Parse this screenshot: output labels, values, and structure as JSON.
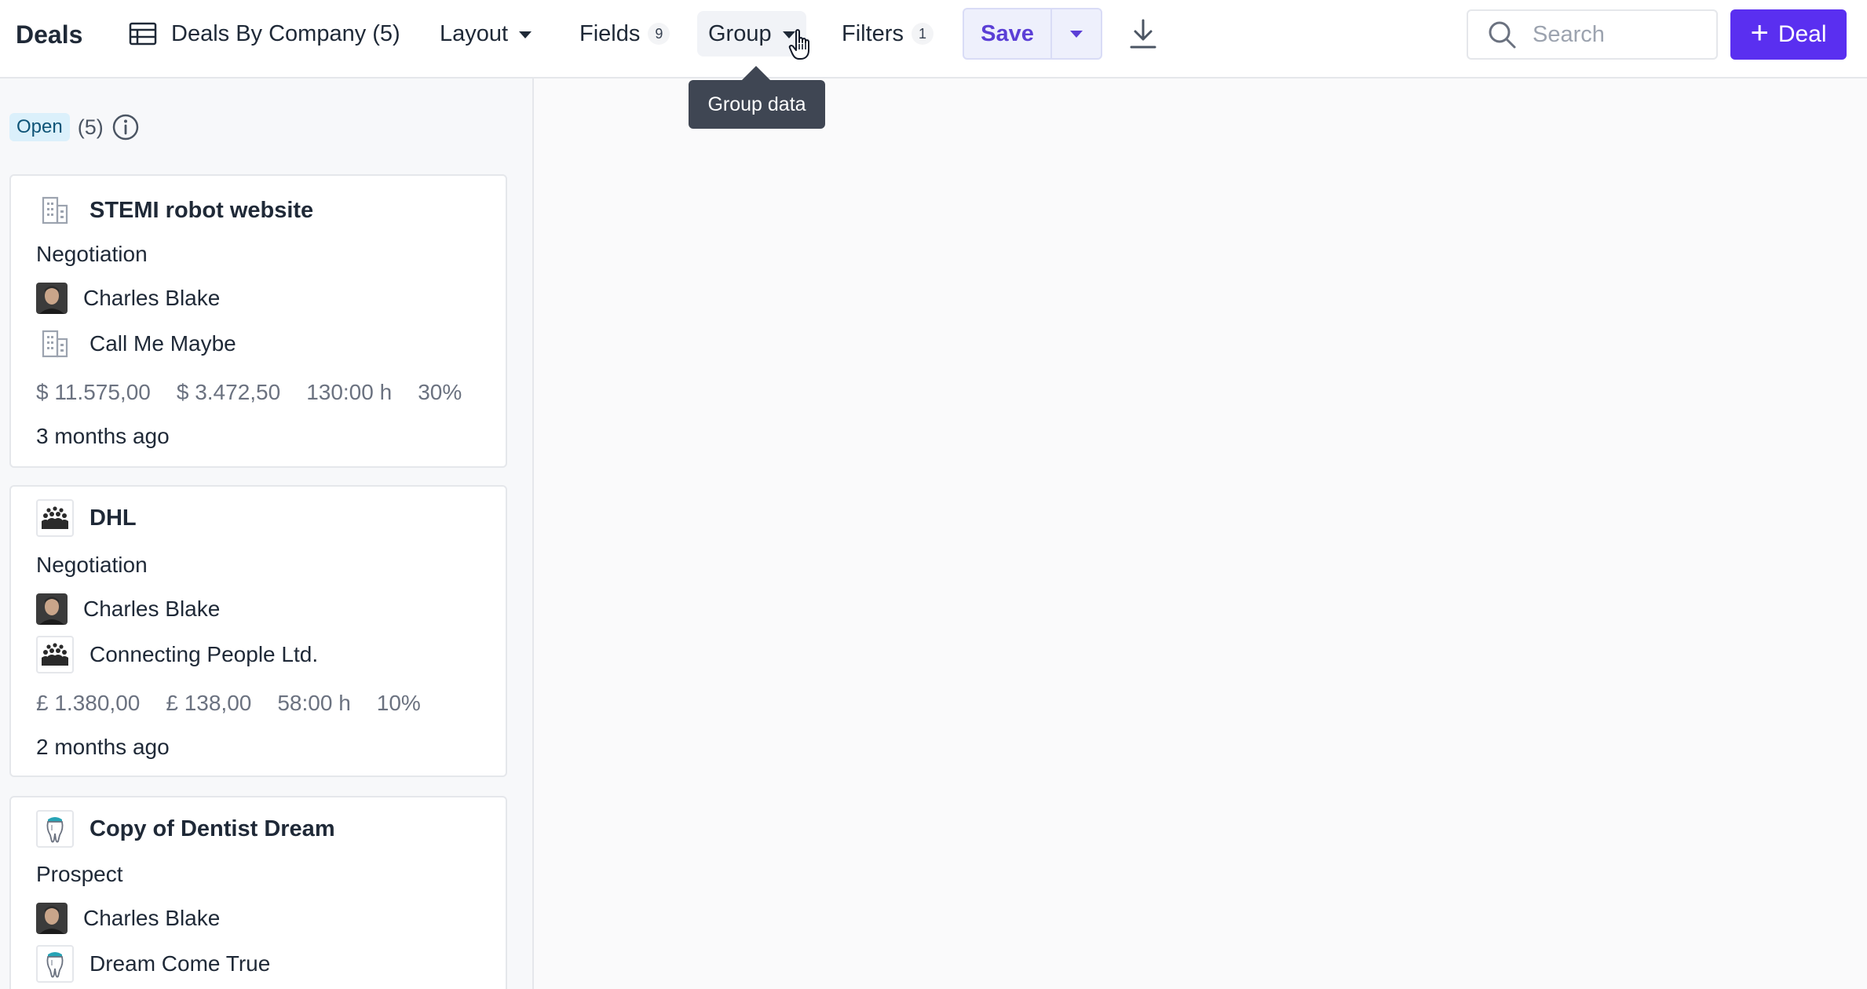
{
  "app": {
    "title": "Deals"
  },
  "toolbar": {
    "view_label": "Deals By Company (5)",
    "layout_label": "Layout",
    "fields_label": "Fields",
    "fields_count": "9",
    "group_label": "Group",
    "filters_label": "Filters",
    "filters_count": "1",
    "save_label": "Save",
    "search_placeholder": "Search",
    "add_deal_label": "Deal"
  },
  "tooltip": {
    "text": "Group data"
  },
  "column": {
    "stage": "Open",
    "count": "(5)"
  },
  "cards": [
    {
      "title": "STEMI robot website",
      "stage": "Negotiation",
      "owner": "Charles Blake",
      "company": "Call Me Maybe",
      "company_icon": "office-building-icon",
      "value": "$ 11.575,00",
      "weighted": "$ 3.472,50",
      "hours": "130:00 h",
      "probability": "30%",
      "updated": "3 months ago"
    },
    {
      "title": "DHL",
      "stage": "Negotiation",
      "owner": "Charles Blake",
      "company": "Connecting People Ltd.",
      "company_icon": "people-group-icon",
      "value": "£ 1.380,00",
      "weighted": "£ 138,00",
      "hours": "58:00 h",
      "probability": "10%",
      "updated": "2 months ago"
    },
    {
      "title": "Copy of Dentist Dream",
      "stage": "Prospect",
      "owner": "Charles Blake",
      "company": "Dream Come True",
      "company_icon": "tooth-icon"
    }
  ],
  "colors": {
    "accent": "#5a2ff0",
    "stage_badge_bg": "#dbf0fb",
    "tooltip_bg": "#3f4653"
  }
}
